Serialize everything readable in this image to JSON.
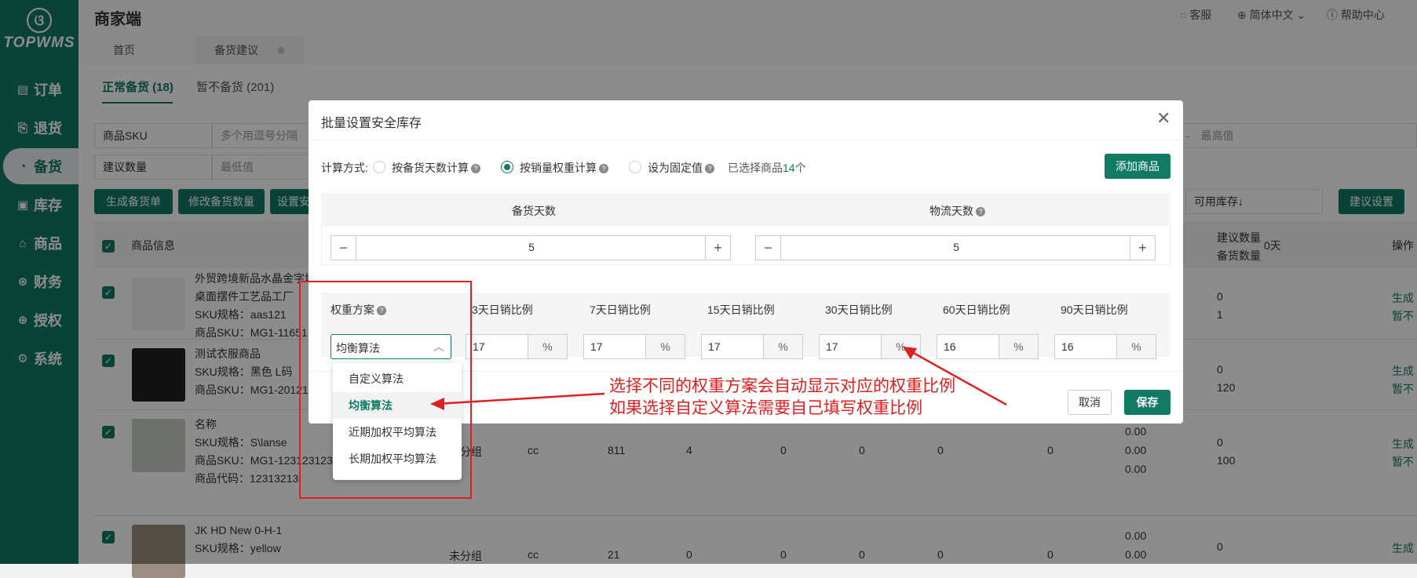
{
  "app": {
    "logo_text": "TOPWMS",
    "title": "商家端"
  },
  "sidebar": {
    "items": [
      {
        "label": "订单",
        "icon": "document-icon"
      },
      {
        "label": "退货",
        "icon": "return-icon"
      },
      {
        "label": "备货",
        "icon": "cart-icon"
      },
      {
        "label": "库存",
        "icon": "inventory-icon"
      },
      {
        "label": "商品",
        "icon": "bag-icon"
      },
      {
        "label": "财务",
        "icon": "finance-icon"
      },
      {
        "label": "授权",
        "icon": "auth-icon"
      },
      {
        "label": "系统",
        "icon": "settings-icon"
      }
    ]
  },
  "header": {
    "support": "客服",
    "language": "简体中文",
    "help": "帮助中心",
    "tabs": [
      "首页",
      "备货建议"
    ]
  },
  "page": {
    "subtabs": [
      "正常备货 (18)",
      "暂不备货 (201)"
    ],
    "filters": {
      "sku_select": "商品SKU",
      "sku_placeholder": "多个用逗号分隔",
      "qty_select": "建议数量",
      "min_placeholder": "最低值",
      "range_dash": "-",
      "max_placeholder": "最高值",
      "sort_select": "可用库存↓"
    },
    "buttons": {
      "generate": "生成备货单",
      "modify": "修改备货数量",
      "set": "设置安",
      "suggest_settings": "建议设置"
    },
    "table": {
      "headers": {
        "product_info": "商品信息",
        "days_suffix": "0天",
        "suggest_qty": "建议数量",
        "stock_qty": "备货数量",
        "ops": "操作"
      },
      "rows": [
        {
          "name1": "外贸跨境新品水晶金字塔",
          "name2": "桌面摆件工艺品工厂",
          "spec": "SKU规格：aas121",
          "sku": "商品SKU：MG1-11651",
          "q1": "0",
          "q2": "1",
          "op1": "生成",
          "op2": "暂不"
        },
        {
          "name1": "测试衣服商品",
          "spec": "SKU规格：黑色 L码",
          "sku": "商品SKU：MG1-20121",
          "q1": "0",
          "q2": "120",
          "op1": "生成",
          "op2": "暂不"
        },
        {
          "name1": "名称",
          "spec": "SKU规格：S\\lanse",
          "sku": "商品SKU：MG1-123123123",
          "code": "商品代码：12313213",
          "group": "未分组",
          "wh": "cc",
          "c1": "811",
          "c2": "4",
          "c3": "0",
          "c4": "0",
          "c5": "0",
          "c6": "0",
          "r1": "0.00",
          "r2": "0.00",
          "r3": "0.00",
          "q1": "0",
          "q2": "100",
          "op1": "生成",
          "op2": "暂不"
        },
        {
          "name1": "JK HD New 0-H-1",
          "spec": "SKU规格：yellow",
          "group": "未分组",
          "wh": "cc",
          "c1": "21",
          "c2": "0",
          "c3": "0",
          "c4": "0",
          "c5": "0",
          "c6": "0",
          "r1": "0.00",
          "r2": "0.00",
          "q1": "0",
          "op1": "生成"
        }
      ]
    }
  },
  "modal": {
    "title": "批量设置安全库存",
    "calc_label": "计算方式:",
    "options": [
      "按备货天数计算",
      "按销量权重计算",
      "设为固定值"
    ],
    "selected_prefix": "已选择商品",
    "selected_count": "14",
    "selected_suffix": "个",
    "add_button": "添加商品",
    "stock_days_label": "备货天数",
    "logistics_days_label": "物流天数",
    "stock_days_value": "5",
    "logistics_days_value": "5",
    "weight_scheme_label": "权重方案",
    "weight_scheme_value": "均衡算法",
    "weight_headers": [
      "3天日销比例",
      "7天日销比例",
      "15天日销比例",
      "30天日销比例",
      "60天日销比例",
      "90天日销比例"
    ],
    "weight_values": [
      "17",
      "17",
      "17",
      "17",
      "16",
      "16"
    ],
    "percent": "%",
    "cancel": "取消",
    "save": "保存",
    "dropdown_options": [
      "自定义算法",
      "均衡算法",
      "近期加权平均算法",
      "长期加权平均算法"
    ]
  },
  "annotation": {
    "line1": "选择不同的权重方案会自动显示对应的权重比例",
    "line2": "如果选择自定义算法需要自己填写权重比例",
    "color": "#e02020"
  }
}
